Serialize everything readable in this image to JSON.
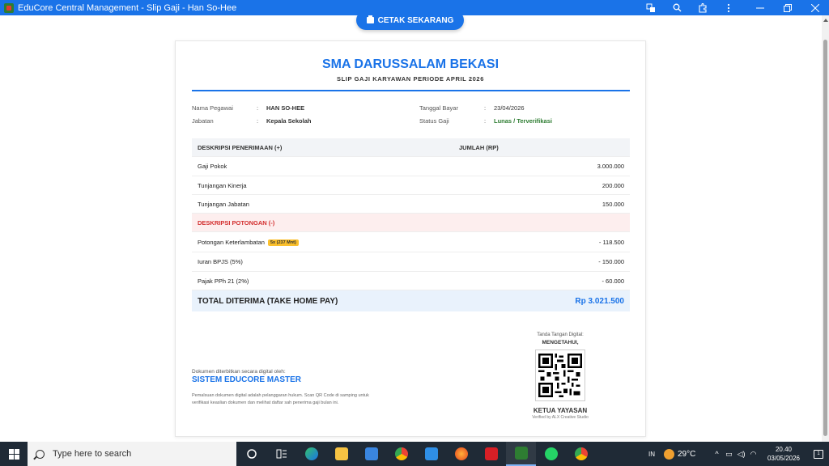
{
  "window": {
    "title": "EduCore Central Management - Slip Gaji - Han So-Hee",
    "controls": [
      "minimize",
      "restore",
      "close"
    ]
  },
  "toolbar": {
    "print_label": "CETAK SEKARANG"
  },
  "slip": {
    "school_name": "SMA DARUSSALAM BEKASI",
    "subtitle": "SLIP GAJI KARYAWAN PERIODE APRIL 2026",
    "info_left": [
      {
        "label": "Nama Pegawai",
        "value": "HAN SO-HEE"
      },
      {
        "label": "Jabatan",
        "value": "Kepala Sekolah"
      }
    ],
    "info_right": [
      {
        "label": "Tanggal Bayar",
        "value": "23/04/2026"
      },
      {
        "label": "Status Gaji",
        "value": "Lunas / Terverifikasi"
      }
    ],
    "colon": ":",
    "income_header": {
      "desc": "DESKRIPSI PENERIMAAN (+)",
      "amount": "JUMLAH (RP)"
    },
    "income": [
      {
        "desc": "Gaji Pokok",
        "amount": "3.000.000"
      },
      {
        "desc": "Tunjangan Kinerja",
        "amount": "200.000"
      },
      {
        "desc": "Tunjangan Jabatan",
        "amount": "150.000"
      }
    ],
    "deduction_header": "DESKRIPSI POTONGAN (-)",
    "deductions": [
      {
        "desc": "Potongan Keterlambatan",
        "badge": "5x (237 Mnt)",
        "amount": "- 118.500"
      },
      {
        "desc": "Iuran BPJS (5%)",
        "amount": "- 150.000"
      },
      {
        "desc": "Pajak PPh 21 (2%)",
        "amount": "- 60.000"
      }
    ],
    "total": {
      "label": "TOTAL DITERIMA (TAKE HOME PAY)",
      "amount": "Rp 3.021.500"
    },
    "issued_by_caption": "Dokumen diterbitkan secara digital oleh:",
    "issued_by": "SISTEM EDUCORE MASTER",
    "legal_note": "Pemalsuan dokumen digital adalah pelanggaran hukum. Scan QR Code di samping untuk verifikasi keaslian dokumen dan melihat daftar sah penerima gaji bulan ini.",
    "signature_caption": "Tanda Tangan Digital:",
    "signature_acknowledged": "MENGETAHUI,",
    "signer_title": "KETUA YAYASAN",
    "verified_by": "Verified by ALX Creative Studio"
  },
  "taskbar": {
    "search_placeholder": "Type here to search",
    "apps": [
      "task-view",
      "widgets",
      "edge",
      "file-explorer",
      "store",
      "chrome",
      "mail",
      "firefox",
      "app-red",
      "educore",
      "whatsapp",
      "chrome-profile"
    ],
    "language": "IN",
    "weather": "29°C",
    "time": "20.40",
    "date": "03/05/2026",
    "notification_count": "1"
  },
  "colors": {
    "accent": "#1a73e8",
    "status_ok": "#2e7d32",
    "deduction": "#d32f2f",
    "badge": "#fbc02d"
  }
}
